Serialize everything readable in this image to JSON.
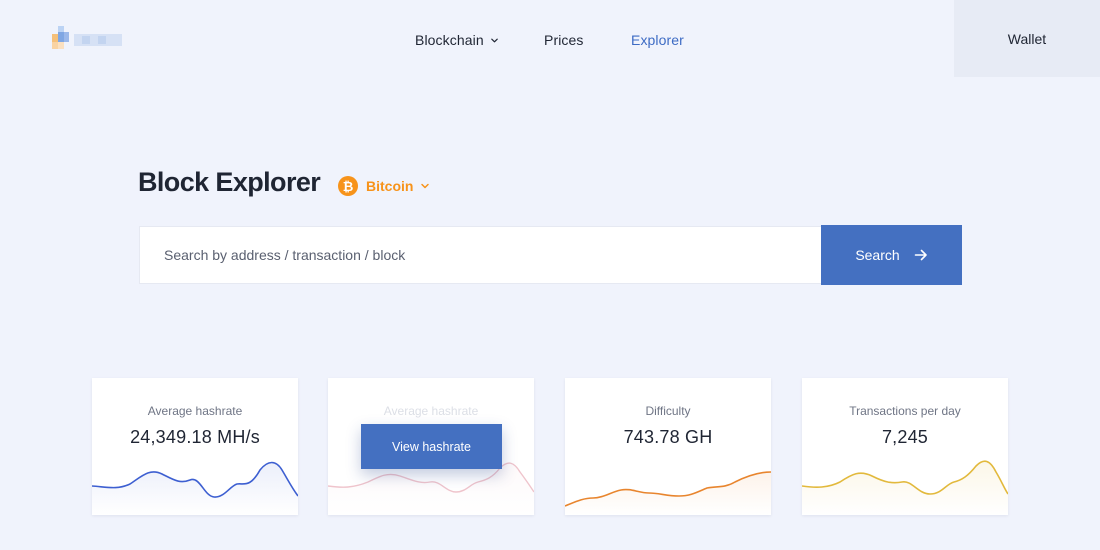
{
  "header": {
    "nav": {
      "blockchain": "Blockchain",
      "prices": "Prices",
      "explorer": "Explorer"
    },
    "wallet": "Wallet",
    "active_nav": "explorer"
  },
  "explorer": {
    "title": "Block Explorer",
    "coin": "Bitcoin",
    "coin_symbol": "₿",
    "coin_color": "#f7931a"
  },
  "search": {
    "placeholder": "Search by address / transaction / block",
    "value": "",
    "button": "Search"
  },
  "cards": [
    {
      "label": "Average hashrate",
      "value": "24,349.18 MH/s",
      "color": "#3d5fd1"
    },
    {
      "label": "Average hashrate",
      "value": "",
      "color": "#efc4cc",
      "hover_button": "View hashrate"
    },
    {
      "label": "Difficulty",
      "value": "743.78 GH",
      "color": "#e8852e"
    },
    {
      "label": "Transactions per day",
      "value": "7,245",
      "color": "#e2b93c"
    }
  ],
  "colors": {
    "accent": "#4470c1",
    "nav_active": "#3d6bc4",
    "background": "#f0f3fc"
  }
}
